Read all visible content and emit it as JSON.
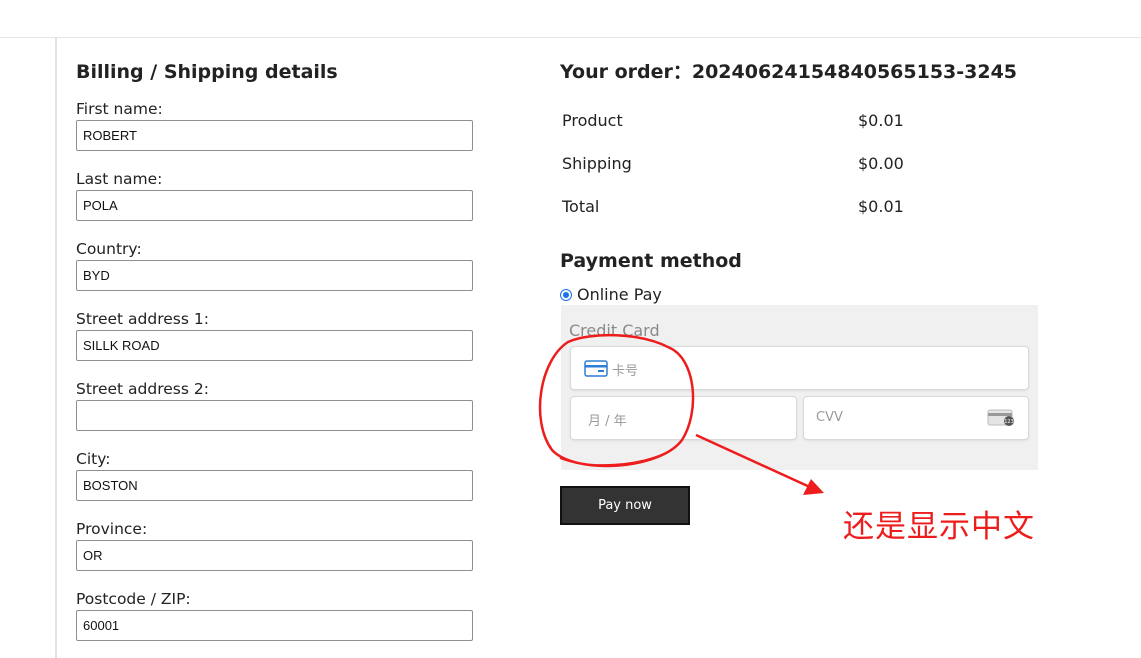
{
  "billing": {
    "title": "Billing / Shipping details",
    "fields": [
      {
        "label": "First name:",
        "value": "ROBERT"
      },
      {
        "label": "Last name:",
        "value": "POLA"
      },
      {
        "label": "Country:",
        "value": "BYD"
      },
      {
        "label": "Street address 1:",
        "value": "SILLK ROAD"
      },
      {
        "label": "Street address 2:",
        "value": ""
      },
      {
        "label": "City:",
        "value": "BOSTON"
      },
      {
        "label": "Province:",
        "value": "OR"
      },
      {
        "label": "Postcode / ZIP:",
        "value": "60001"
      }
    ]
  },
  "order": {
    "title": "Your order：20240624154840565153-3245",
    "rows": [
      {
        "label": "Product",
        "amount": "$0.01"
      },
      {
        "label": "Shipping",
        "amount": "$0.00"
      },
      {
        "label": "Total",
        "amount": "$0.01"
      }
    ]
  },
  "payment": {
    "title": "Payment method",
    "option_label": "Online Pay",
    "option_selected": true,
    "card_title": "Credit Card",
    "card_number_placeholder": "卡号",
    "expiry_placeholder": "月 / 年",
    "cvv_placeholder": "CVV",
    "pay_button": "Pay now"
  },
  "annotation": {
    "text": "还是显示中文",
    "color": "#ee1d1d"
  },
  "colors": {
    "accent": "#1a73e8",
    "button_bg": "#333333"
  }
}
